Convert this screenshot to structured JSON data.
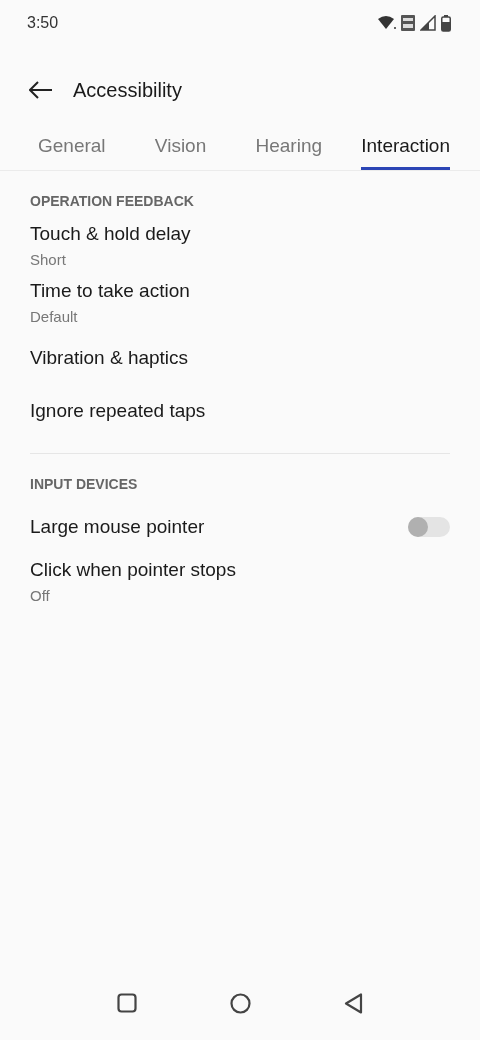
{
  "status_bar": {
    "time": "3:50"
  },
  "header": {
    "title": "Accessibility"
  },
  "tabs": [
    {
      "label": "General",
      "selected": false
    },
    {
      "label": "Vision",
      "selected": false
    },
    {
      "label": "Hearing",
      "selected": false
    },
    {
      "label": "Interaction",
      "selected": true
    }
  ],
  "sections": [
    {
      "title": "OPERATION FEEDBACK",
      "items": [
        {
          "kind": "link",
          "title": "Touch & hold delay",
          "summary": "Short"
        },
        {
          "kind": "link",
          "title": "Time to take action",
          "summary": "Default"
        },
        {
          "kind": "link",
          "title": "Vibration & haptics"
        },
        {
          "kind": "link",
          "title": "Ignore repeated taps"
        }
      ]
    },
    {
      "title": "INPUT DEVICES",
      "items": [
        {
          "kind": "switch",
          "title": "Large mouse pointer",
          "on": false
        },
        {
          "kind": "link",
          "title": "Click when pointer stops",
          "summary": "Off"
        }
      ]
    }
  ]
}
